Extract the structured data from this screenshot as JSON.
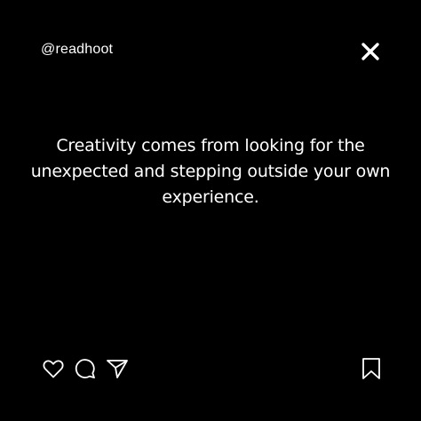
{
  "post": {
    "handle": "@readhoot",
    "quote": "Creativity comes from looking for the unexpected and stepping outside your own experience."
  },
  "icons": {
    "close": "close-icon",
    "like": "heart-icon",
    "comment": "comment-icon",
    "share": "send-icon",
    "save": "bookmark-icon"
  },
  "colors": {
    "background": "#000000",
    "foreground": "#ffffff"
  }
}
